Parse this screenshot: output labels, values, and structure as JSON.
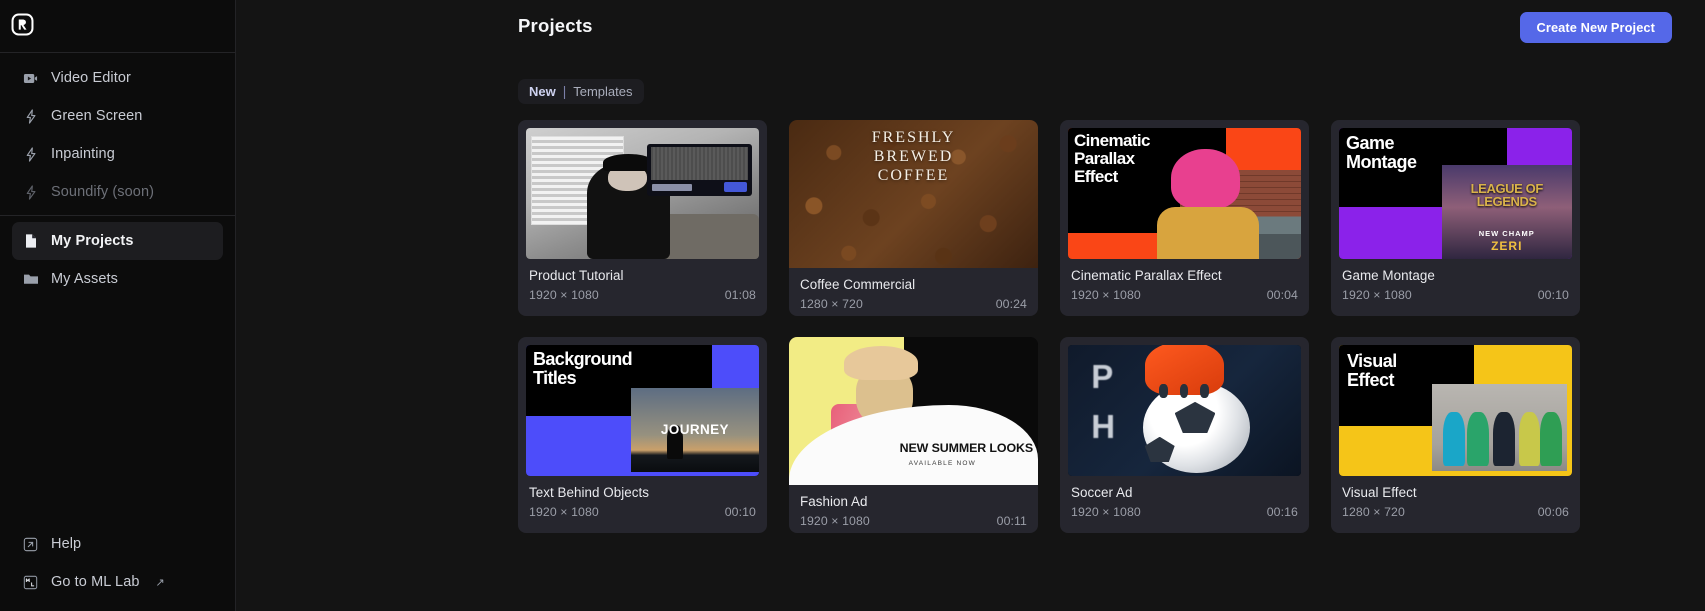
{
  "brand": {
    "logo_icon": "runway-logo-icon"
  },
  "colors": {
    "accent": "#5568e8",
    "sidebar_bg": "#0c0c0c",
    "main_bg": "#141414",
    "card_bg": "#26262e",
    "active_item_bg": "#1d1d20"
  },
  "sidebar": {
    "tools": [
      {
        "label": "Video Editor",
        "icon": "video-icon",
        "state": "normal"
      },
      {
        "label": "Green Screen",
        "icon": "bolt-icon",
        "state": "normal"
      },
      {
        "label": "Inpainting",
        "icon": "bolt-icon",
        "state": "normal"
      },
      {
        "label": "Soundify (soon)",
        "icon": "bolt-icon",
        "state": "disabled"
      }
    ],
    "library": [
      {
        "label": "My Projects",
        "icon": "file-icon",
        "state": "active"
      },
      {
        "label": "My Assets",
        "icon": "folder-icon",
        "state": "normal"
      }
    ],
    "bottom": [
      {
        "label": "Help",
        "icon": "help-external-icon",
        "external": ""
      },
      {
        "label": "Go to ML Lab",
        "icon": "ml-lab-icon",
        "external": "↗"
      }
    ]
  },
  "header": {
    "title": "Projects",
    "create_button": "Create New Project"
  },
  "tabs": {
    "active": "New",
    "separator": "|",
    "inactive": "Templates"
  },
  "projects": [
    {
      "title": "Product Tutorial",
      "dimensions": "1920 × 1080",
      "duration": "01:08",
      "thumb": "product-tutorial-thumb"
    },
    {
      "title": "Coffee Commercial",
      "dimensions": "1280 × 720",
      "duration": "00:24",
      "thumb": "coffee-commercial-thumb",
      "art_text": [
        "FRESHLY",
        "BREWED",
        "COFFEE"
      ]
    },
    {
      "title": "Cinematic Parallax Effect",
      "dimensions": "1920 × 1080",
      "duration": "00:04",
      "thumb": "cinematic-parallax-thumb",
      "art_text": [
        "Cinematic",
        "Parallax",
        "Effect"
      ]
    },
    {
      "title": "Game Montage",
      "dimensions": "1920 × 1080",
      "duration": "00:10",
      "thumb": "game-montage-thumb",
      "art_text": [
        "Game",
        "Montage"
      ],
      "art_overlay": {
        "league": "LEAGUE OF LEGENDS",
        "champ": "NEW CHAMP",
        "name": "ZERI"
      }
    },
    {
      "title": "Text Behind Objects",
      "dimensions": "1920 × 1080",
      "duration": "00:10",
      "thumb": "text-behind-objects-thumb",
      "art_text": [
        "Background",
        "Titles"
      ],
      "art_overlay": {
        "word": "JOURNEY"
      }
    },
    {
      "title": "Fashion Ad",
      "dimensions": "1920 × 1080",
      "duration": "00:11",
      "thumb": "fashion-ad-thumb",
      "art_overlay": {
        "headline": "NEW SUMMER LOOKS",
        "subhead": "AVAILABLE NOW"
      }
    },
    {
      "title": "Soccer Ad",
      "dimensions": "1920 × 1080",
      "duration": "00:16",
      "thumb": "soccer-ad-thumb",
      "art_overlay": {
        "line1": "P  Y",
        "line2": "H  R"
      }
    },
    {
      "title": "Visual Effect",
      "dimensions": "1280 × 720",
      "duration": "00:06",
      "thumb": "visual-effect-thumb",
      "art_text": [
        "Visual",
        "Effect"
      ]
    }
  ]
}
